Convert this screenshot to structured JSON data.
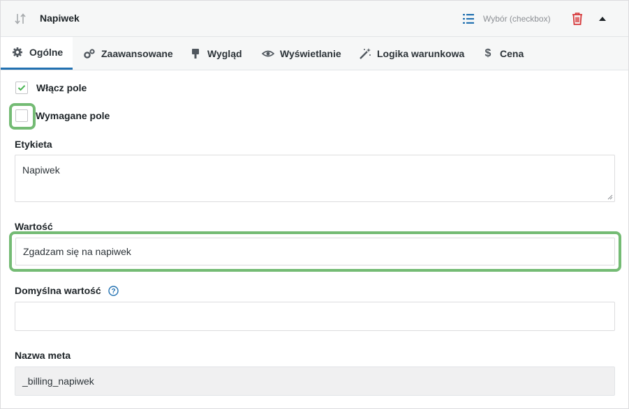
{
  "header": {
    "title": "Napiwek",
    "field_type": "Wybór (checkbox)",
    "icons": {
      "sort": "sort-arrows-icon",
      "type": "list-icon",
      "delete": "trash-icon",
      "collapse": "caret-up-icon"
    },
    "colors": {
      "type_icon": "#2271b1",
      "delete_icon": "#d63638"
    }
  },
  "tabs": [
    {
      "label": "Ogólne",
      "icon": "gear-icon",
      "active": true
    },
    {
      "label": "Zaawansowane",
      "icon": "gears-icon"
    },
    {
      "label": "Wygląd",
      "icon": "brush-icon"
    },
    {
      "label": "Wyświetlanie",
      "icon": "eye-icon"
    },
    {
      "label": "Logika warunkowa",
      "icon": "magic-wand-icon"
    },
    {
      "label": "Cena",
      "icon": "dollar-icon"
    }
  ],
  "form": {
    "enable": {
      "label": "Włącz pole",
      "checked": true
    },
    "required": {
      "label": "Wymagane pole",
      "checked": false
    },
    "label_field": {
      "label": "Etykieta",
      "value": "Napiwek"
    },
    "value_field": {
      "label": "Wartość",
      "value": "Zgadzam się na napiwek"
    },
    "default_field": {
      "label": "Domyślna wartość",
      "value": ""
    },
    "meta_field": {
      "label": "Nazwa meta",
      "value": "_billing_napiwek"
    }
  },
  "colors": {
    "accent": "#2271b1",
    "highlight": "#74bb74",
    "check": "#46b450"
  }
}
